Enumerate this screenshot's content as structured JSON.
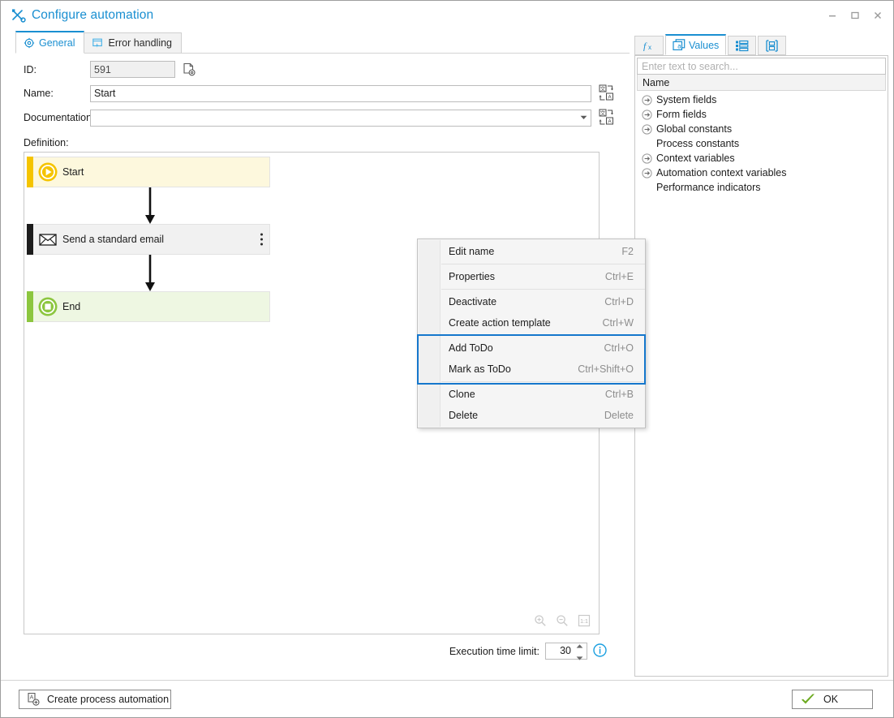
{
  "window": {
    "title": "Configure automation",
    "title_icon": "tools-wrench-screwdriver-icon",
    "accent_color": "#1a8fd1",
    "controls": {
      "minimize": "–",
      "maximize": "□",
      "close": "✕"
    }
  },
  "left": {
    "tabs": [
      {
        "label": "General",
        "icon": "gear-icon",
        "active": true
      },
      {
        "label": "Error handling",
        "icon": "window-lightning-icon",
        "active": false
      }
    ],
    "fields": {
      "id_label": "ID:",
      "id_value": "591",
      "id_action_icon": "document-gear-icon",
      "name_label": "Name:",
      "name_value": "Start",
      "name_translate_icon": "translate-icon",
      "documentation_label": "Documentation:",
      "documentation_value": "",
      "documentation_translate_icon": "translate-icon",
      "definition_label": "Definition:"
    },
    "canvas": {
      "nodes": [
        {
          "id": "start",
          "label": "Start",
          "icon": "play-circle-icon",
          "bar_color": "#f5c400",
          "fill_color": "#fdf8dd",
          "has_dots_menu": false
        },
        {
          "id": "email",
          "label": "Send a standard email",
          "icon": "envelope-icon",
          "bar_color": "#1c1c1c",
          "fill_color": "#f1f1f1",
          "has_dots_menu": true
        },
        {
          "id": "end",
          "label": "End",
          "icon": "stop-circle-icon",
          "bar_color": "#8cc63f",
          "fill_color": "#eef7e2",
          "has_dots_menu": false
        }
      ],
      "zoom_controls": [
        {
          "name": "zoom-in-icon"
        },
        {
          "name": "zoom-out-icon"
        },
        {
          "name": "zoom-reset-icon",
          "label": "1:1"
        }
      ]
    },
    "execution": {
      "label": "Execution time limit:",
      "value": "30",
      "info_icon": "info-circle-icon"
    }
  },
  "context_menu": {
    "highlight_color": "#1577cc",
    "items": [
      {
        "label": "Edit name",
        "accel": "F2",
        "separator_after": true
      },
      {
        "label": "Properties",
        "accel": "Ctrl+E",
        "separator_after": true
      },
      {
        "label": "Deactivate",
        "accel": "Ctrl+D",
        "separator_after": false
      },
      {
        "label": "Create action template",
        "accel": "Ctrl+W",
        "separator_after": true
      },
      {
        "label": "Add ToDo",
        "accel": "Ctrl+O",
        "separator_after": false,
        "highlighted": true
      },
      {
        "label": "Mark as ToDo",
        "accel": "Ctrl+Shift+O",
        "separator_after": true,
        "highlighted": true
      },
      {
        "label": "Clone",
        "accel": "Ctrl+B",
        "separator_after": false
      },
      {
        "label": "Delete",
        "accel": "Delete",
        "separator_after": false
      }
    ]
  },
  "right": {
    "tabs": [
      {
        "label": "",
        "icon": "function-fx-icon",
        "active": false
      },
      {
        "label": "Values",
        "icon": "values-a-icon",
        "active": true
      },
      {
        "label": "",
        "icon": "list-detail-icon",
        "active": false
      },
      {
        "label": "",
        "icon": "document-layout-icon",
        "active": false
      }
    ],
    "search_placeholder": "Enter text to search...",
    "search_value": "",
    "column_header": "Name",
    "tree_items": [
      {
        "label": "System fields",
        "expandable": true
      },
      {
        "label": "Form fields",
        "expandable": true
      },
      {
        "label": "Global constants",
        "expandable": true
      },
      {
        "label": "Process constants",
        "expandable": false
      },
      {
        "label": "Context variables",
        "expandable": true
      },
      {
        "label": "Automation context variables",
        "expandable": true
      },
      {
        "label": "Performance indicators",
        "expandable": false
      }
    ]
  },
  "footer": {
    "create_button_label": "Create process automation",
    "create_button_icon": "add-automation-icon",
    "ok_button_label": "OK",
    "ok_button_icon": "green-check-icon"
  }
}
